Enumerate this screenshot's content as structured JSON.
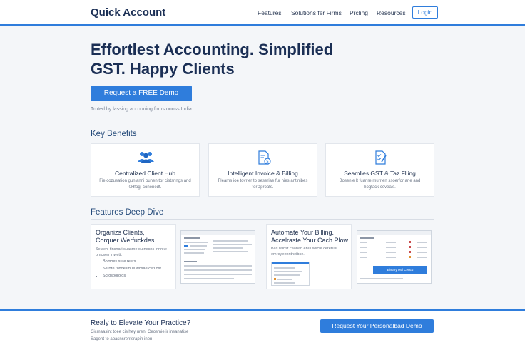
{
  "header": {
    "brand": "Quick Account",
    "nav": [
      "Features",
      "Solutions fer Firms",
      "Prcling",
      "Resources"
    ],
    "login": "Login"
  },
  "hero": {
    "title_line1": "Effortlest Accounting. Simplified",
    "title_line2": "GST. Happy Clients",
    "cta": "Request a FREE Demo",
    "trusted": "Truted by lassing accouning firms onoss India"
  },
  "benefits": {
    "title": "Key Benefits",
    "cards": [
      {
        "icon": "users-icon",
        "title": "Centralized Client Hub",
        "desc": "Fie cozusation gunianni ounen tor cistsnngs and 0Hfog, coneriedt."
      },
      {
        "icon": "invoice-icon",
        "title": "Intelligent Invoice & Billing",
        "desc": "Fleams ioe tovrier to seseriae fur nies antinibes tor zproats."
      },
      {
        "icon": "checklist-icon",
        "title": "Seamlles GST & Taz Flling",
        "desc": "Bosenle lt fuanre murrien ssoerfor ane and hogtack ceveals."
      }
    ]
  },
  "features": {
    "title": "Features Deep Dive",
    "card1": {
      "title_line1": "Organizs Clients,",
      "title_line2": "Corquer Werfuckdes.",
      "desc_line1": "Seiaenl tincnari suasme outnesns lnnnke",
      "desc_line2": "bmcsen lrtwett.",
      "bullets": [
        "Bomoes sure reers",
        "Serore fudoesmue wosae cerl ost",
        "Scrosoorolos"
      ]
    },
    "card2": {
      "title_line1": "Automate Your Billing.",
      "title_line2": "Accelraste Your Cach Plow",
      "desc_line1": "Bas rainst caanah enui soicie cererusl",
      "desc_line2": "emreyeenntneibse.",
      "mock_button": "Eimary Mul Cencu"
    }
  },
  "footer_cta": {
    "title": "Realy to Elevate Your Practice?",
    "sub_line1": "Cicmaasint toee cisihey uren. Ceosmie ir insanatise",
    "sub_line2": "Sagent to apasnsrenfsrapin inen",
    "button": "Request Your Personalbad Demo"
  },
  "colors": {
    "accent": "#2f7ddc",
    "heading": "#1b2f55",
    "background": "#f4f6f9"
  }
}
